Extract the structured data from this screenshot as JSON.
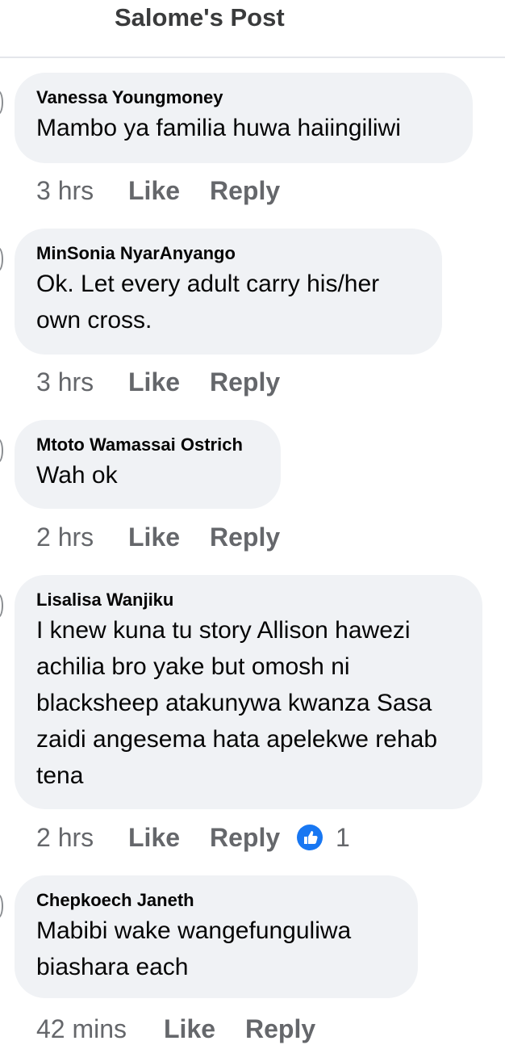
{
  "header": {
    "title": "Salome's Post"
  },
  "comments": [
    {
      "author": "Vanessa Youngmoney",
      "text": "Mambo ya familia huwa haiingiliwi",
      "time": "3 hrs",
      "like": "Like",
      "reply": "Reply"
    },
    {
      "author": "MinSonia NyarAnyango",
      "text": "Ok. Let every adult carry his/her own cross.",
      "time": "3 hrs",
      "like": "Like",
      "reply": "Reply"
    },
    {
      "author": "Mtoto Wamassai Ostrich",
      "text": "Wah ok",
      "time": "2 hrs",
      "like": "Like",
      "reply": "Reply"
    },
    {
      "author": "Lisalisa Wanjiku",
      "text": "I knew kuna tu story Allison hawezi achilia bro yake but omosh ni blacksheep atakunywa kwanza Sasa zaidi angesema hata apelekwe rehab tena",
      "time": "2 hrs",
      "like": "Like",
      "reply": "Reply",
      "reaction_icon": "like-thumb-icon",
      "reaction_count": "1"
    },
    {
      "author": "Chepkoech Janeth",
      "text": "Mabibi wake wangefunguliwa biashara each",
      "time": "42 mins",
      "like": "Like",
      "reply": "Reply"
    }
  ],
  "colors": {
    "bubble": "#f0f2f5",
    "meta": "#65676b",
    "like_reaction": "#1877f2"
  }
}
